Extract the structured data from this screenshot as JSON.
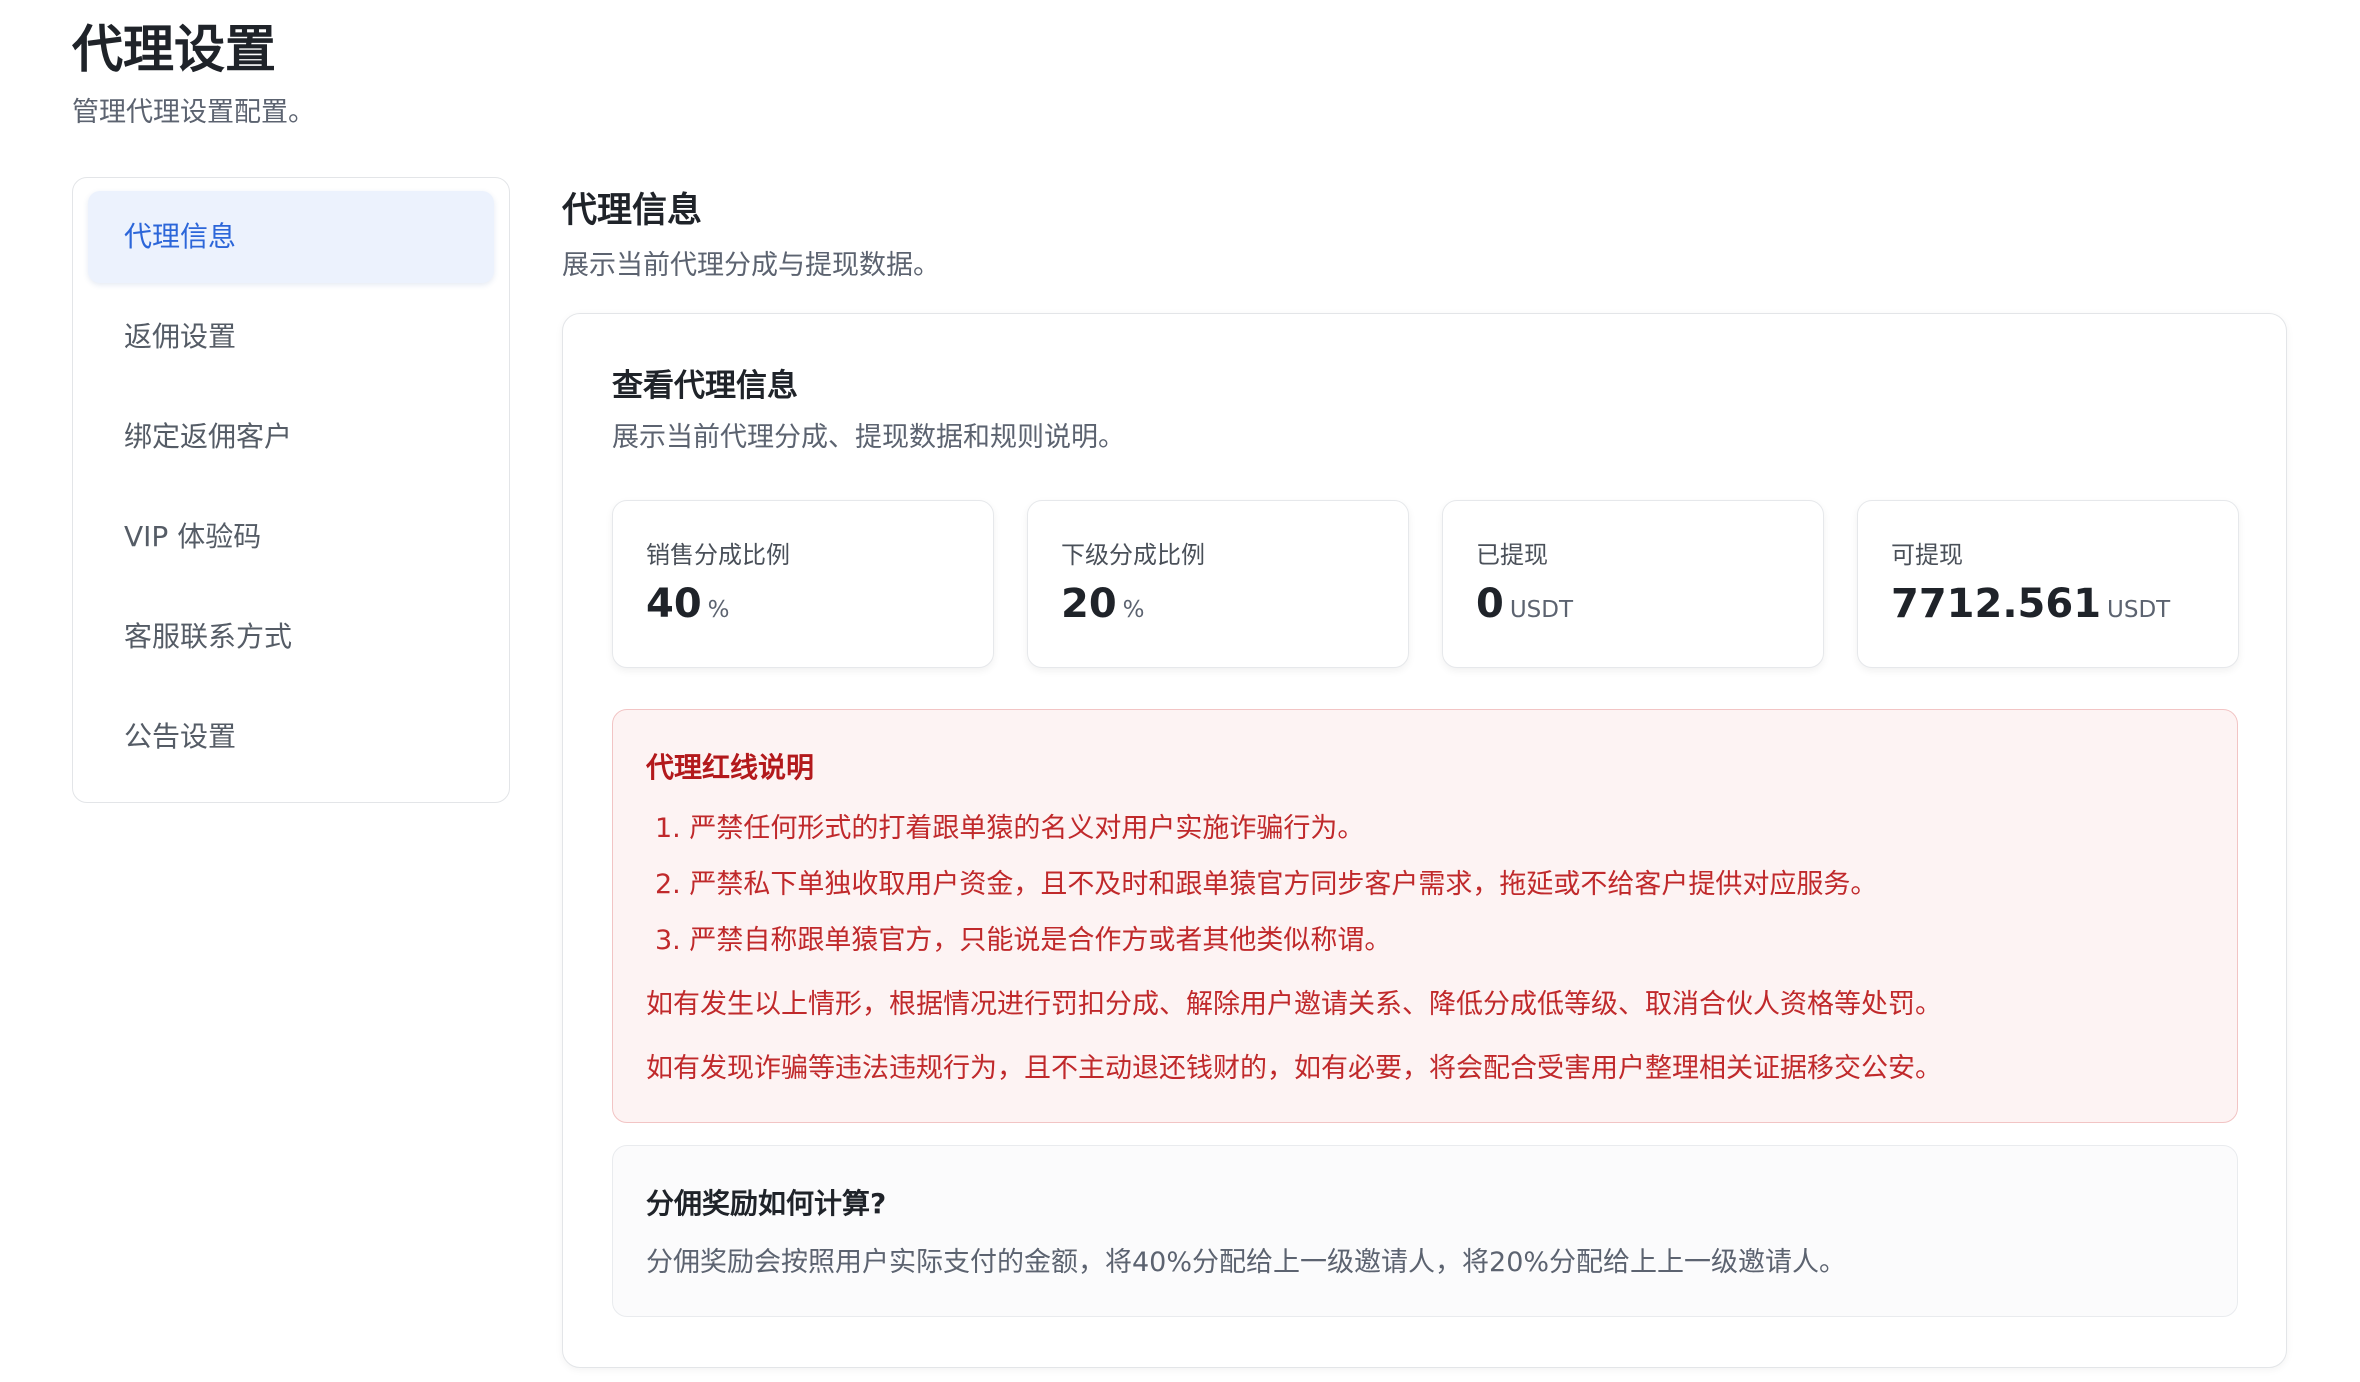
{
  "page": {
    "title": "代理设置",
    "subtitle": "管理代理设置配置。"
  },
  "sidebar": {
    "items": [
      {
        "label": "代理信息",
        "active": true
      },
      {
        "label": "返佣设置",
        "active": false
      },
      {
        "label": "绑定返佣客户",
        "active": false
      },
      {
        "label": "VIP 体验码",
        "active": false
      },
      {
        "label": "客服联系方式",
        "active": false
      },
      {
        "label": "公告设置",
        "active": false
      }
    ]
  },
  "section": {
    "title": "代理信息",
    "subtitle": "展示当前代理分成与提现数据。"
  },
  "card": {
    "title": "查看代理信息",
    "subtitle": "展示当前代理分成、提现数据和规则说明。"
  },
  "stats": [
    {
      "label": "销售分成比例",
      "value": "40",
      "unit": "%"
    },
    {
      "label": "下级分成比例",
      "value": "20",
      "unit": "%"
    },
    {
      "label": "已提现",
      "value": "0",
      "unit": "USDT"
    },
    {
      "label": "可提现",
      "value": "7712.561",
      "unit": "USDT"
    }
  ],
  "redline": {
    "title": "代理红线说明",
    "rules": [
      "1. 严禁任何形式的打着跟单猿的名义对用户实施诈骗行为。",
      "2. 严禁私下单独收取用户资金，且不及时和跟单猿官方同步客户需求，拖延或不给客户提供对应服务。",
      "3. 严禁自称跟单猿官方，只能说是合作方或者其他类似称谓。"
    ],
    "notes": [
      "如有发生以上情形，根据情况进行罚扣分成、解除用户邀请关系、降低分成低等级、取消合伙人资格等处罚。",
      "如有发现诈骗等违法违规行为，且不主动退还钱财的，如有必要，将会配合受害用户整理相关证据移交公安。"
    ]
  },
  "faq": {
    "question": "分佣奖励如何计算?",
    "answer": "分佣奖励会按照用户实际支付的金额，将40%分配给上一级邀请人，将20%分配给上上一级邀请人。"
  },
  "colors": {
    "accent": "#2c66d9",
    "active_bg": "#ecf2fd",
    "danger": "#c0292b",
    "danger_bg": "#fdf3f3"
  }
}
